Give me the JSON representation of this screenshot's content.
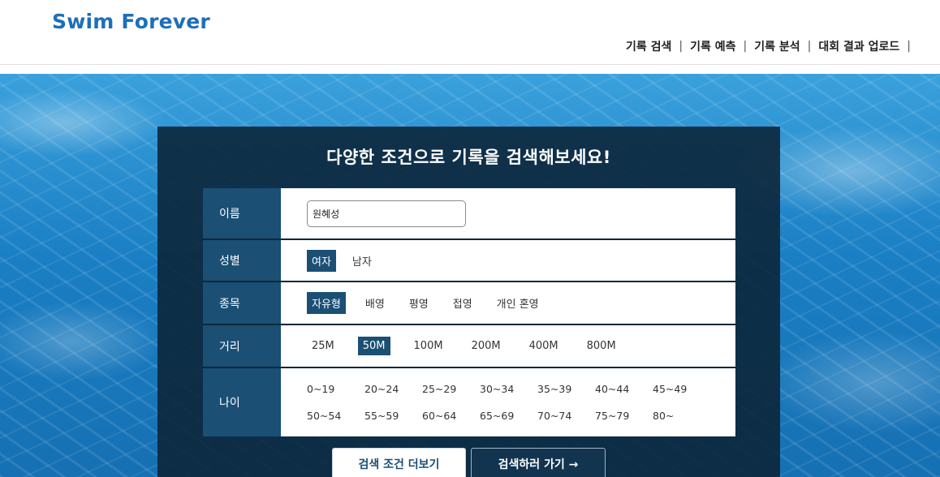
{
  "header": {
    "logo": "Swim Forever",
    "nav": [
      {
        "label": "기록 검색"
      },
      {
        "label": "기록 예측"
      },
      {
        "label": "기록 분석"
      },
      {
        "label": "대회 결과 업로드"
      }
    ],
    "separator": "|"
  },
  "panel": {
    "title": "다양한 조건으로 기록을 검색해보세요!"
  },
  "form": {
    "name": {
      "label": "이름",
      "value": "원혜성"
    },
    "gender": {
      "label": "성별",
      "options": [
        "여자",
        "남자"
      ],
      "selected": "여자"
    },
    "event": {
      "label": "종목",
      "options": [
        "자유형",
        "배영",
        "평영",
        "접영",
        "개인 혼영"
      ],
      "selected": "자유형"
    },
    "distance": {
      "label": "거리",
      "options": [
        "25M",
        "50M",
        "100M",
        "200M",
        "400M",
        "800M"
      ],
      "selected": "50M"
    },
    "age": {
      "label": "나이",
      "row1": [
        "0~19",
        "20~24",
        "25~29",
        "30~34",
        "35~39",
        "40~44",
        "45~49"
      ],
      "row2": [
        "50~54",
        "55~59",
        "60~64",
        "65~69",
        "70~74",
        "75~79",
        "80~"
      ]
    }
  },
  "buttons": {
    "more": "검색 조건 더보기",
    "go": "검색하러 가기 →"
  },
  "colors": {
    "brand": "#1d6fb8",
    "selected": "#1b4f74",
    "panel": "#0c263a"
  }
}
